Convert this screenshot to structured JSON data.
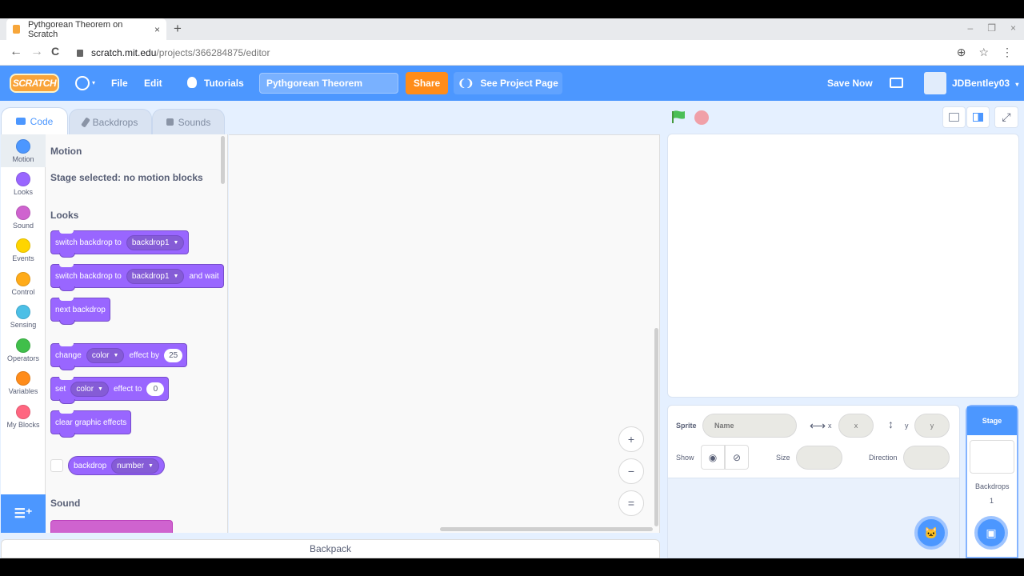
{
  "browser": {
    "tab_title": "Pythgorean Theorem on Scratch",
    "tab_close": "×",
    "new_tab": "+",
    "url_domain": "scratch.mit.edu",
    "url_path": "/projects/366284875/editor",
    "nav": {
      "back": "←",
      "forward": "→",
      "reload": "C"
    },
    "window_controls": {
      "minimize": "–",
      "restore": "❐",
      "close": "×"
    },
    "addr_icons": {
      "zoom": "⊕",
      "bookmark": "☆",
      "menu": "⋮"
    }
  },
  "menubar": {
    "logo": "SCRATCH",
    "language_caret": "▾",
    "file": "File",
    "edit": "Edit",
    "tutorials": "Tutorials",
    "project_title": "Pythgorean Theorem",
    "share": "Share",
    "see_project_page": "See Project Page",
    "see_project_icon": "❨❩",
    "save_now": "Save Now",
    "username": "JDBentley03",
    "user_caret": "▾"
  },
  "editor_tabs": [
    {
      "label": "Code",
      "active": true
    },
    {
      "label": "Backdrops",
      "active": false
    },
    {
      "label": "Sounds",
      "active": false
    }
  ],
  "categories": [
    {
      "label": "Motion",
      "color": "#4c97ff",
      "selected": true
    },
    {
      "label": "Looks",
      "color": "#9966ff",
      "selected": false
    },
    {
      "label": "Sound",
      "color": "#cf63cf",
      "selected": false
    },
    {
      "label": "Events",
      "color": "#ffd500",
      "selected": false
    },
    {
      "label": "Control",
      "color": "#ffab19",
      "selected": false
    },
    {
      "label": "Sensing",
      "color": "#4cbfe6",
      "selected": false
    },
    {
      "label": "Operators",
      "color": "#40bf4a",
      "selected": false
    },
    {
      "label": "Variables",
      "color": "#ff8c1a",
      "selected": false
    },
    {
      "label": "My Blocks",
      "color": "#ff6680",
      "selected": false
    }
  ],
  "palette": {
    "motion_heading": "Motion",
    "motion_note": "Stage selected: no motion blocks",
    "looks_heading": "Looks",
    "sound_heading": "Sound",
    "blocks": {
      "switch1": {
        "text": "switch backdrop to",
        "menu": "backdrop1"
      },
      "switch2": {
        "text": "switch backdrop to",
        "menu": "backdrop1",
        "suffix": "and wait"
      },
      "next": {
        "text": "next backdrop"
      },
      "change": {
        "text": "change",
        "menu": "color",
        "mid": "effect by",
        "value": "25"
      },
      "set": {
        "text": "set",
        "menu": "color",
        "mid": "effect to",
        "value": "0"
      },
      "clear": {
        "text": "clear graphic effects"
      },
      "reporter": {
        "text": "backdrop",
        "menu": "number"
      }
    },
    "dropdown_caret": "▼"
  },
  "workspace": {
    "zoom_in": "+",
    "zoom_out": "−",
    "reset": "="
  },
  "backpack": "Backpack",
  "sprite_info": {
    "sprite_label": "Sprite",
    "name_placeholder": "Name",
    "x_label": "x",
    "x_placeholder": "x",
    "y_label": "y",
    "y_placeholder": "y",
    "show_label": "Show",
    "size_label": "Size",
    "direction_label": "Direction",
    "x_arrow": "⟷",
    "y_arrow": "↕"
  },
  "stage_selector": {
    "heading": "Stage",
    "backdrops_label": "Backdrops",
    "backdrops_count": "1"
  }
}
